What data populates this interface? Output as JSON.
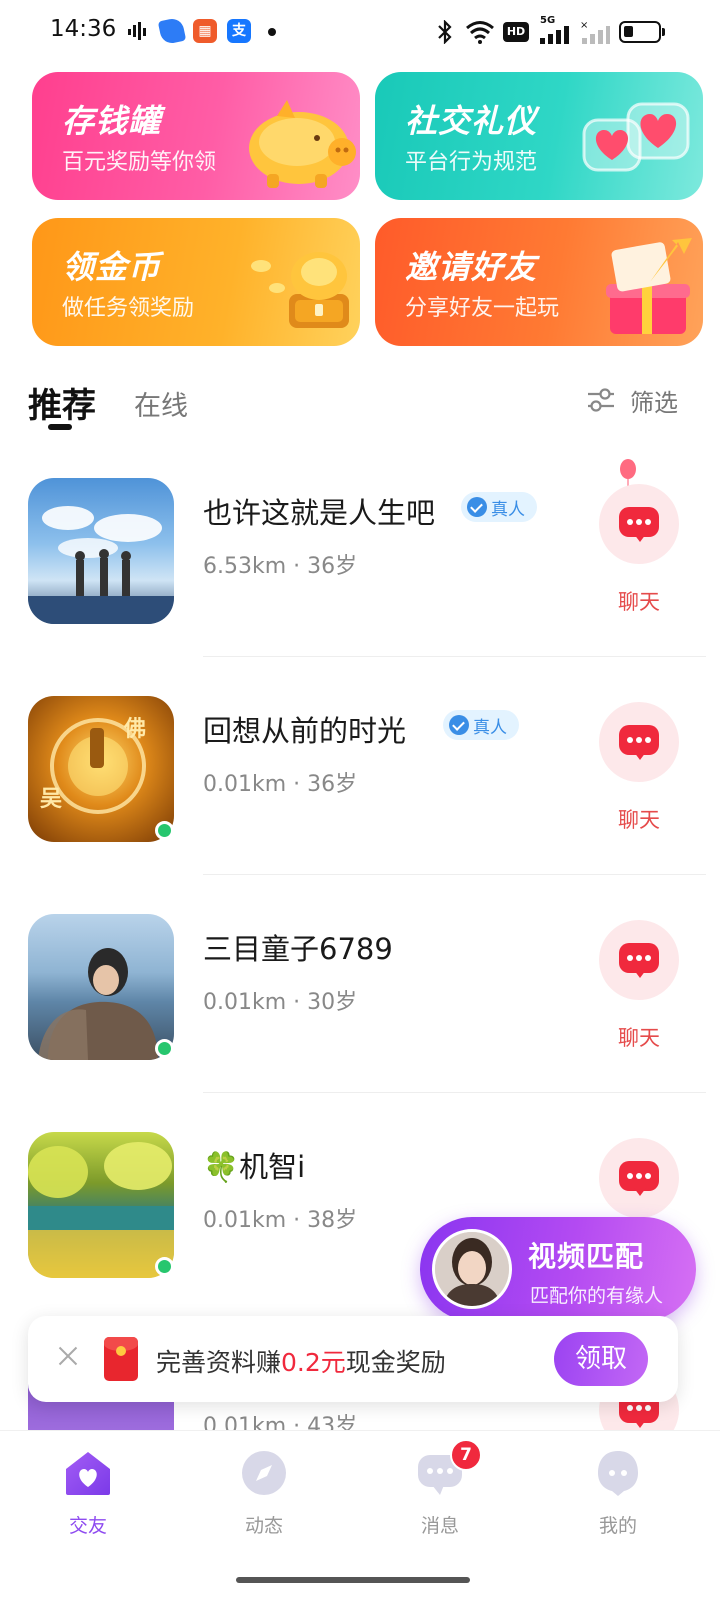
{
  "status_bar": {
    "time": "14:36",
    "app_icons": [
      "signal-meter-icon",
      "blue-app-icon",
      "orange-app-icon",
      "alipay-icon"
    ],
    "right_icons": [
      "bluetooth-icon",
      "wifi-icon",
      "hd-icon",
      "5g-signal-icon",
      "signal-icon",
      "battery-icon"
    ],
    "hd_label": "HD",
    "network": "5G"
  },
  "banners": [
    {
      "title": "存钱罐",
      "subtitle": "百元奖励等你领"
    },
    {
      "title": "社交礼仪",
      "subtitle": "平台行为规范"
    },
    {
      "title": "领金币",
      "subtitle": "做任务领奖励"
    },
    {
      "title": "邀请好友",
      "subtitle": "分享好友一起玩"
    }
  ],
  "tabs": {
    "recommend": "推荐",
    "online": "在线",
    "filter": "筛选"
  },
  "users": [
    {
      "name": "也许这就是人生吧",
      "verified_label": "真人",
      "distance": "6.53km",
      "age": "36岁",
      "chat_label": "聊天"
    },
    {
      "name": "回想从前的时光",
      "verified_label": "真人",
      "distance": "0.01km",
      "age": "36岁",
      "chat_label": "聊天"
    },
    {
      "name": "三目童子6789",
      "distance": "0.01km",
      "age": "30岁",
      "chat_label": "聊天"
    },
    {
      "name": "🍀机智i",
      "distance": "0.01km",
      "age": "38岁"
    },
    {
      "distance": "0.01km",
      "age": "43岁"
    }
  ],
  "video_match": {
    "title": "视频匹配",
    "subtitle": "匹配你的有缘人"
  },
  "reward_toast": {
    "text_before": "完善资料赚",
    "amount": "0.2元",
    "text_after": "现金奖励",
    "button": "领取"
  },
  "bottom_nav": {
    "items": [
      {
        "label": "交友",
        "icon": "home-heart-icon"
      },
      {
        "label": "动态",
        "icon": "compass-icon"
      },
      {
        "label": "消息",
        "icon": "message-icon",
        "badge": "7"
      },
      {
        "label": "我的",
        "icon": "profile-icon"
      }
    ]
  },
  "colors": {
    "accent_purple": "#8e4bf0",
    "chat_red": "#f0293d",
    "online_green": "#27c66e"
  }
}
